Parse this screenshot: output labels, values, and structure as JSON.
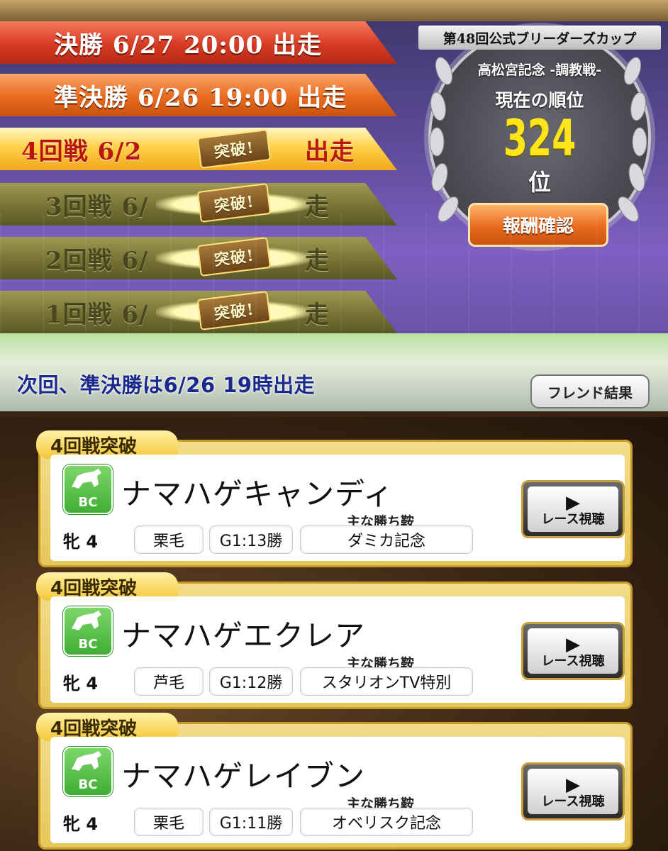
{
  "rounds": {
    "final": "決勝 6/27 20:00 出走",
    "semi": "準決勝 6/26 19:00 出走",
    "r4_left": "4回戦 6/2",
    "r4_right": "出走",
    "r3_left": "3回戦 6/",
    "r2_left": "2回戦 6/",
    "r1_left": "1回戦 6/",
    "passed_right": "走",
    "cleared_badge": "突破!"
  },
  "ranking": {
    "title": "第48回公式ブリーダーズカップ",
    "subtitle": "高松宮記念 -調教戦-",
    "label": "現在の順位",
    "value": "324",
    "unit": "位",
    "reward_button": "報酬確認"
  },
  "next_info": "次回、準決勝は6/26 19時出走",
  "friend_button": "フレンド結果",
  "win_label": "主な勝ち鞍",
  "watch_button": "レース視聴",
  "bc_label": "BC",
  "horses": [
    {
      "tag": "4回戦突破",
      "name": "ナマハゲキャンディ",
      "sex_age": "牝 4",
      "coat": "栗毛",
      "g1": "G1:13勝",
      "race": "ダミカ記念"
    },
    {
      "tag": "4回戦突破",
      "name": "ナマハゲエクレア",
      "sex_age": "牝 4",
      "coat": "芦毛",
      "g1": "G1:12勝",
      "race": "スタリオンTV特別"
    },
    {
      "tag": "4回戦突破",
      "name": "ナマハゲレイブン",
      "sex_age": "牝 4",
      "coat": "栗毛",
      "g1": "G1:11勝",
      "race": "オベリスク記念"
    }
  ]
}
